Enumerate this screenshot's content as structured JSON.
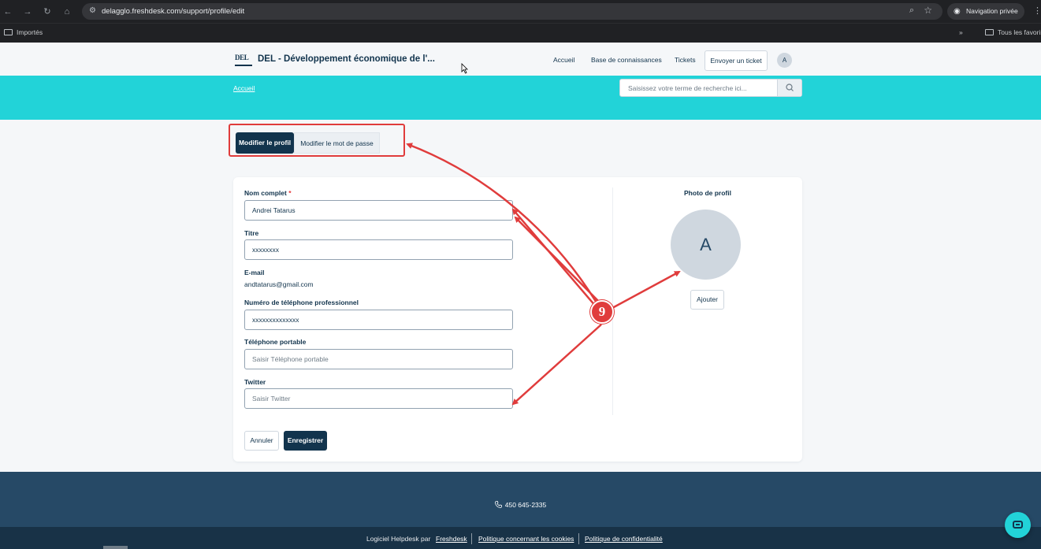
{
  "browser": {
    "url": "delagglo.freshdesk.com/support/profile/edit",
    "incognito_label": "Navigation privée",
    "bookmark_imported": "Importés",
    "bookmark_all": "Tous les favoris",
    "bookmark_more": "»"
  },
  "header": {
    "logo_text": "DEL",
    "portal_title": "DEL - Développement économique de l'...",
    "nav": [
      "Accueil",
      "Base de connaissances",
      "Tickets"
    ],
    "submit_ticket": "Envoyer un ticket",
    "avatar_letter": "A"
  },
  "hero": {
    "breadcrumb": "Accueil",
    "search_placeholder": "Saisissez votre terme de recherche ici..."
  },
  "tabs": {
    "edit_profile": "Modifier le profil",
    "change_password": "Modifier le mot de passe"
  },
  "form": {
    "full_name": {
      "label": "Nom complet",
      "required_mark": "*",
      "value": "Andrei Tatarus"
    },
    "title": {
      "label": "Titre",
      "value": "xxxxxxxx"
    },
    "email": {
      "label": "E-mail",
      "value": "andtatarus@gmail.com"
    },
    "work_phone": {
      "label": "Numéro de téléphone professionnel",
      "value": "xxxxxxxxxxxxxx"
    },
    "mobile": {
      "label": "Téléphone portable",
      "placeholder": "Saisir Téléphone portable"
    },
    "twitter": {
      "label": "Twitter",
      "placeholder": "Saisir Twitter"
    },
    "cancel": "Annuler",
    "save": "Enregistrer"
  },
  "photo": {
    "label": "Photo de profil",
    "avatar_letter": "A",
    "add_button": "Ajouter"
  },
  "annotation": {
    "step_number": "9",
    "color": "#e03c3c"
  },
  "footer": {
    "phone": "450 645-2335",
    "powered_by": "Logiciel Helpdesk par",
    "freshdesk_link": "Freshdesk",
    "cookies_link": "Politique concernant les cookies",
    "privacy_link": "Politique de confidentialité"
  },
  "colors": {
    "primary": "#12344d",
    "hero": "#22d3d8",
    "footer": "#264966",
    "footer_bottom": "#183247"
  }
}
